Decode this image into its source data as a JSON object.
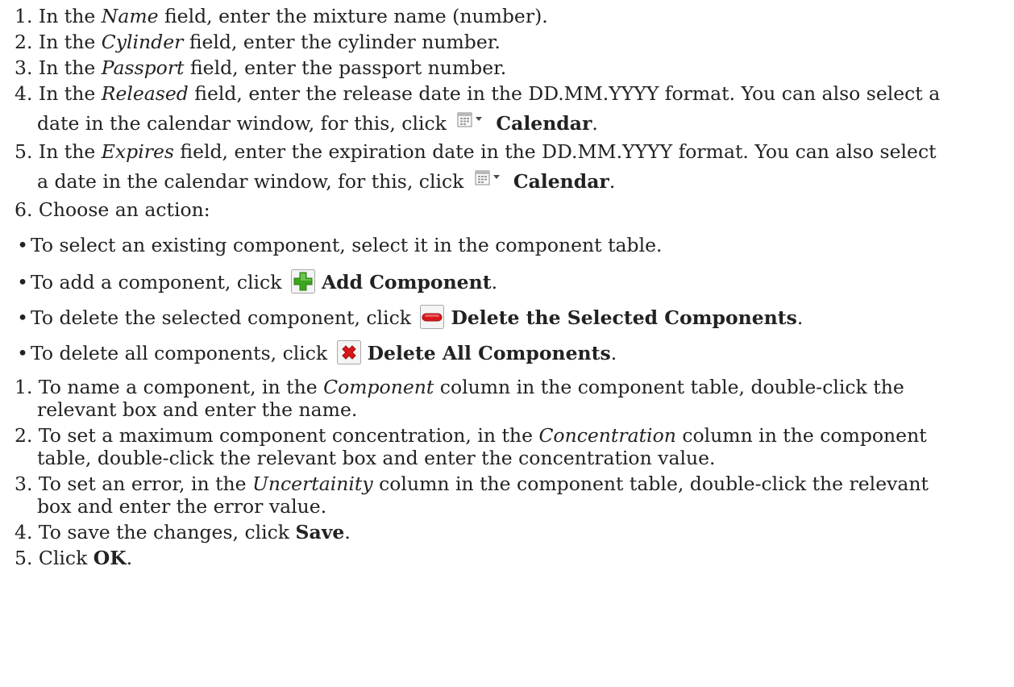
{
  "steps_a": [
    {
      "num": "1.",
      "pre": "In the ",
      "field": "Name",
      "post": " field, enter the mixture name (number)."
    },
    {
      "num": "2.",
      "pre": "In the ",
      "field": "Cylinder",
      "post": " field, enter the cylinder number."
    },
    {
      "num": "3.",
      "pre": "In the ",
      "field": "Passport",
      "post": " field, enter the passport number."
    },
    {
      "num": "4.",
      "pre": "In the ",
      "field": "Released",
      "post": " field, enter the release date in the DD.MM.YYYY format. You can also select a",
      "cont_pre": "date in the calendar window, for this, click",
      "button": "Calendar",
      "cont_post": "."
    },
    {
      "num": "5.",
      "pre": "In the ",
      "field": "Expires",
      "post": " field, enter the expiration date in the DD.MM.YYYY format. You can also select",
      "cont_pre": "a date in the calendar window, for this, click",
      "button": "Calendar",
      "cont_post": "."
    },
    {
      "num": "6.",
      "text": "Choose an action:"
    }
  ],
  "bullets": [
    {
      "mark": "•",
      "text": "To select an existing component, select it in the component table."
    },
    {
      "mark": "•",
      "pre": "To add a component, click",
      "button": "Add Component",
      "post": "."
    },
    {
      "mark": "•",
      "pre": "To delete the selected component, click",
      "button": "Delete the Selected Components",
      "post": "."
    },
    {
      "mark": "•",
      "pre": "To delete all components, click",
      "button": "Delete All Components",
      "post": "."
    }
  ],
  "steps_b": [
    {
      "num": "1.",
      "pre": "To name a component, in the ",
      "col": "Component",
      "post": " column in the component table, double-click the",
      "cont": "relevant box and enter the name."
    },
    {
      "num": "2.",
      "pre": "To set a maximum component concentration, in the ",
      "col": "Concentration",
      "post": " column in the component",
      "cont": "table, double-click the relevant box and enter the concentration value."
    },
    {
      "num": "3.",
      "pre": "To set an error, in the ",
      "col": "Uncertainity",
      "post": " column in the component table, double-click the relevant",
      "cont": "box and enter the error value."
    },
    {
      "num": "4.",
      "pre": "To save the changes, click ",
      "button": "Save",
      "post": "."
    },
    {
      "num": "5.",
      "pre": "Click ",
      "button": "OK",
      "post": "."
    }
  ],
  "icons": {
    "calendar": "calendar-dropdown-icon",
    "add": "green-plus-icon",
    "delete_selected": "red-minus-icon",
    "delete_all": "red-x-icon"
  },
  "colors": {
    "text": "#222222",
    "add_icon": "#3aa51d",
    "delete_icon": "#d8171b"
  }
}
